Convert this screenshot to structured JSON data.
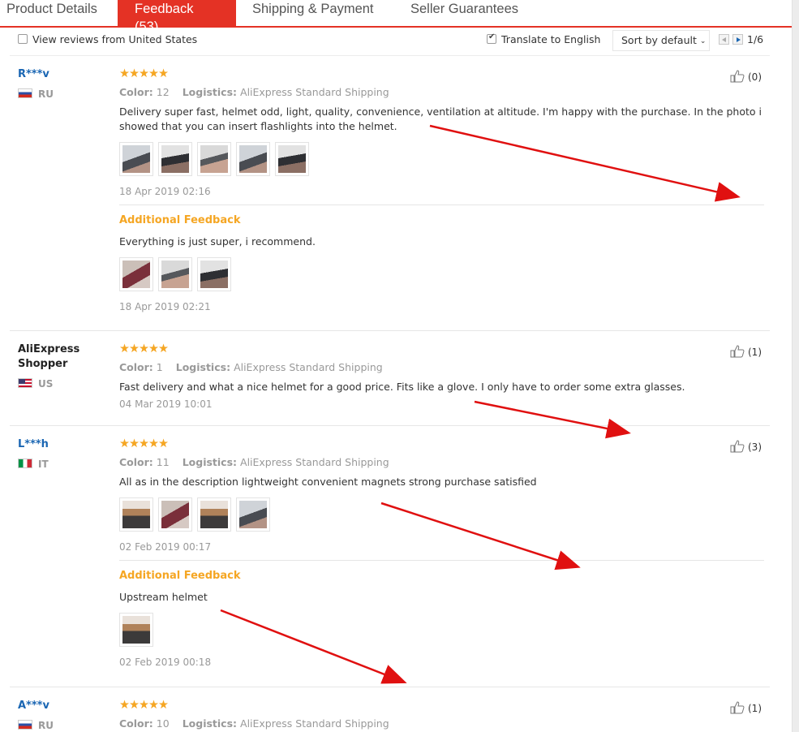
{
  "tabs": [
    {
      "label": "Product Details"
    },
    {
      "label": "Feedback (53)"
    },
    {
      "label": "Shipping & Payment"
    },
    {
      "label": "Seller Guarantees"
    }
  ],
  "filters": {
    "view_us_label": "View reviews from United States",
    "view_us_checked": false,
    "translate_label": "Translate to English",
    "translate_checked": true,
    "sort_label": "Sort by default",
    "page": "1/6"
  },
  "labels": {
    "color": "Color:",
    "logistics": "Logistics:",
    "additional": "Additional Feedback"
  },
  "stars": "★★★★★",
  "reviews": [
    {
      "user": "R***v",
      "country": "RU",
      "color": "12",
      "logistics": "AliExpress Standard Shipping",
      "text": "Delivery super fast, helmet odd, light, quality, convenience, ventilation at altitude. I'm happy with the purchase. In the photo i showed that you can insert flashlights into the helmet.",
      "date": "18 Apr 2019 02:16",
      "likes": "(0)",
      "additional_text": "Everything is just super, i recommend.",
      "additional_date": "18 Apr 2019 02:21"
    },
    {
      "user": "AliExpress Shopper",
      "country": "US",
      "color": "1",
      "logistics": "AliExpress Standard Shipping",
      "text": "Fast delivery and what a nice helmet for a good price. Fits like a glove. I only have to order some extra glasses.",
      "date": "04 Mar 2019 10:01",
      "likes": "(1)"
    },
    {
      "user": "L***h",
      "country": "IT",
      "color": "11",
      "logistics": "AliExpress Standard Shipping",
      "text": "All as in the description lightweight convenient magnets strong purchase satisfied",
      "date": "02 Feb 2019 00:17",
      "likes": "(3)",
      "additional_text": "Upstream helmet",
      "additional_date": "02 Feb 2019 00:18"
    },
    {
      "user": "A***v",
      "country": "RU",
      "color": "10",
      "logistics": "AliExpress Standard Shipping",
      "likes": "(1)"
    }
  ],
  "colors": {
    "accent_red": "#e43225",
    "star_orange": "#f5a623",
    "link_blue": "#1a66b3",
    "annotation_arrow": "#e01010"
  }
}
